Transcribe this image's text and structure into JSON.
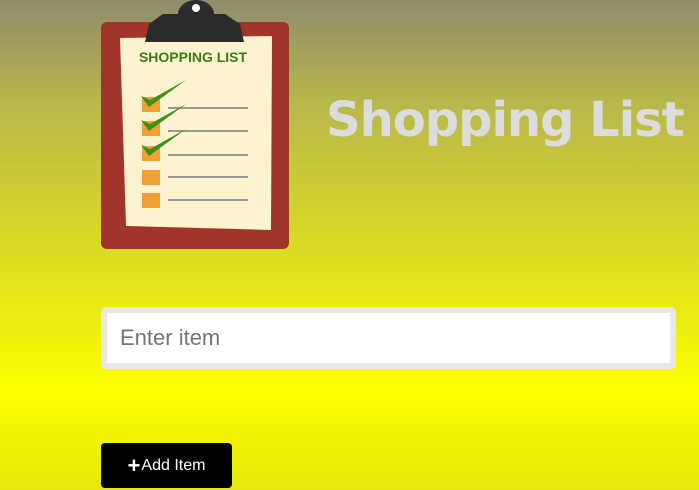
{
  "logo": {
    "icon": "clipboard-checklist-icon",
    "heading": "SHOPPING LIST",
    "colors": {
      "board": "#a3342a",
      "paper": "#fdf3cf",
      "check": "#3f8f1c",
      "box": "#f0a035",
      "clip": "#2b2b2b"
    }
  },
  "header": {
    "title": "Shopping List",
    "title_color": "#dcdcdc"
  },
  "form": {
    "input_placeholder": "Enter item",
    "input_value": "",
    "add_button_label": "Add Item",
    "add_button_icon": "plus-icon",
    "add_button_icon_glyph": "+"
  },
  "background": {
    "gradient_top": "#8f8c6c",
    "gradient_bottom": "#ffff00"
  }
}
